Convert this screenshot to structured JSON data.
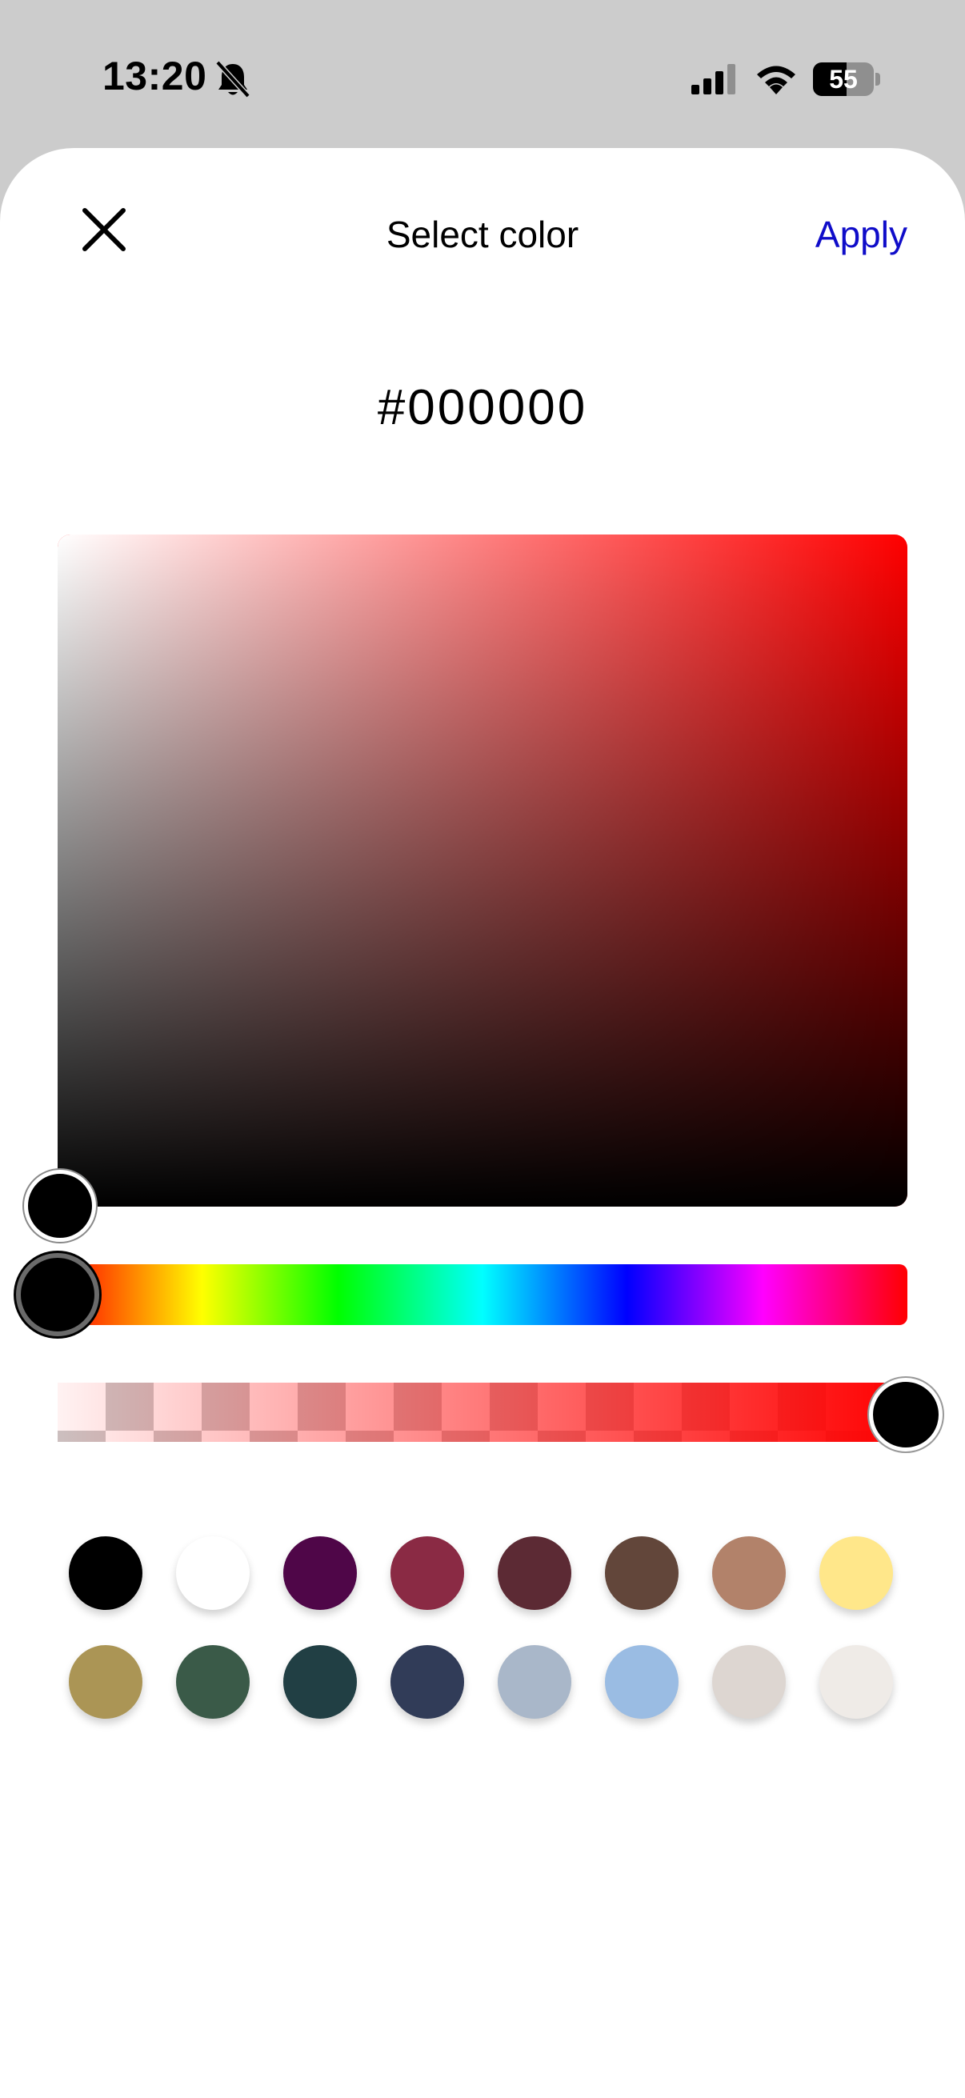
{
  "status_bar": {
    "time": "13:20",
    "battery_level": "55",
    "battery_fraction": 0.55,
    "icons": [
      "bell-slash-icon",
      "cellular-signal-icon",
      "wifi-icon",
      "battery-icon"
    ]
  },
  "header": {
    "close_icon": "close-icon",
    "title": "Select color",
    "apply_label": "Apply",
    "apply_color": "#0f0cc9"
  },
  "picker": {
    "hex_value": "#000000",
    "hue_color": "#ff0000",
    "saturation": 0,
    "brightness": 0,
    "hue_fraction": 0,
    "alpha_fraction": 1
  },
  "swatches": [
    "#000000",
    "#ffffff",
    "#4f0648",
    "#8a2a44",
    "#5c2a34",
    "#62463a",
    "#b2826a",
    "#ffe78a",
    "#ab9555",
    "#3a5a48",
    "#213f44",
    "#313c58",
    "#a9b7c9",
    "#9abce3",
    "#ddd6d1",
    "#efebe7"
  ]
}
